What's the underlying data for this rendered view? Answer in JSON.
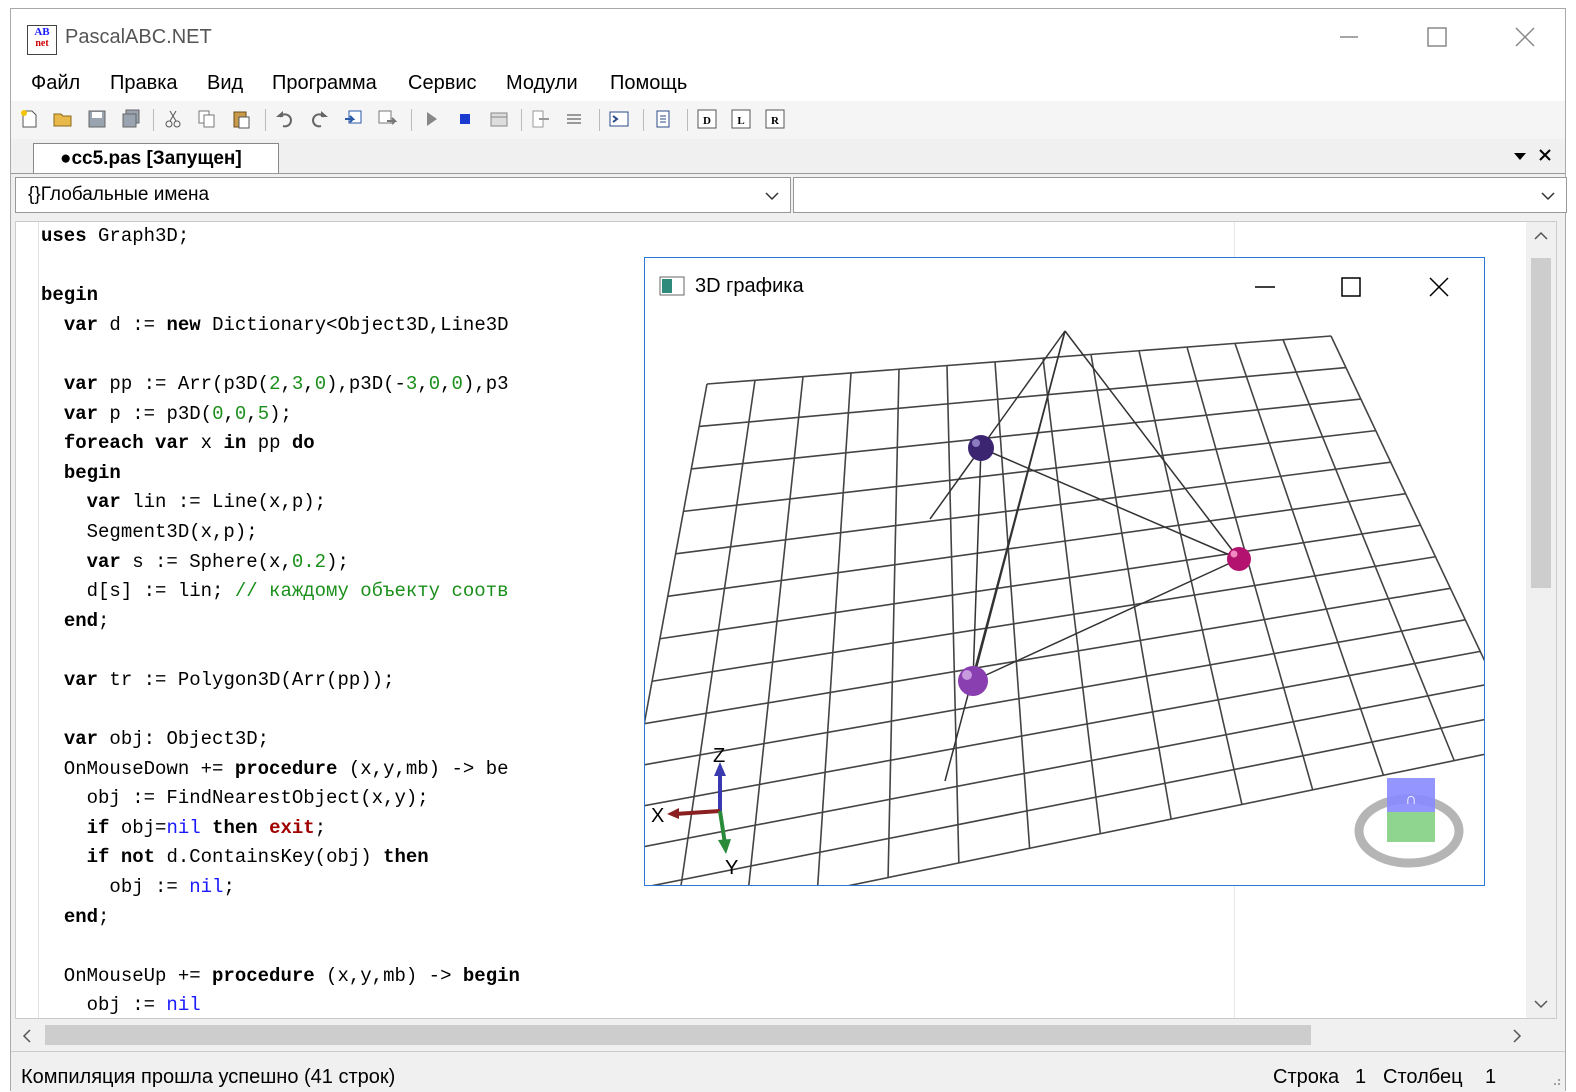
{
  "window": {
    "title": "PascalABC.NET",
    "icon_text": "AB net"
  },
  "menu": [
    "Файл",
    "Правка",
    "Вид",
    "Программа",
    "Сервис",
    "Модули",
    "Помощь"
  ],
  "tab": {
    "label": "●cc5.pas [Запущен]"
  },
  "combos": {
    "left": "{}Глобальные имена",
    "right": ""
  },
  "code_lines": [
    "uses Graph3D;",
    "",
    "begin",
    "  var d := new Dictionary<Object3D,Line3D",
    "",
    "  var pp := Arr(p3D(2,3,0),p3D(-3,0,0),p3",
    "  var p := p3D(0,0,5);",
    "  foreach var x in pp do",
    "  begin",
    "    var lin := Line(x,p);",
    "    Segment3D(x,p);",
    "    var s := Sphere(x,0.2);",
    "    d[s] := lin; // каждому объекту соотв",
    "  end;",
    "",
    "  var tr := Polygon3D(Arr(pp));",
    "",
    "  var obj: Object3D;",
    "  OnMouseDown += procedure (x,y,mb) -> be",
    "    obj := FindNearestObject(x,y);",
    "    if obj=nil then exit;",
    "    if not d.ContainsKey(obj) then",
    "      obj := nil;",
    "  end;",
    "",
    "  OnMouseUp += procedure (x,y,mb) -> begin",
    "    obj := nil"
  ],
  "status": {
    "message": "Компиляция прошла успешно (41 строк)",
    "row_label": "Строка",
    "row": "1",
    "col_label": "Столбец",
    "col": "1"
  },
  "window3d": {
    "title": "3D графика",
    "axis_labels": {
      "x": "X",
      "y": "Y",
      "z": "Z"
    },
    "sphere_colors": [
      "#3b2470",
      "#b3126e",
      "#8a3fb0"
    ]
  }
}
